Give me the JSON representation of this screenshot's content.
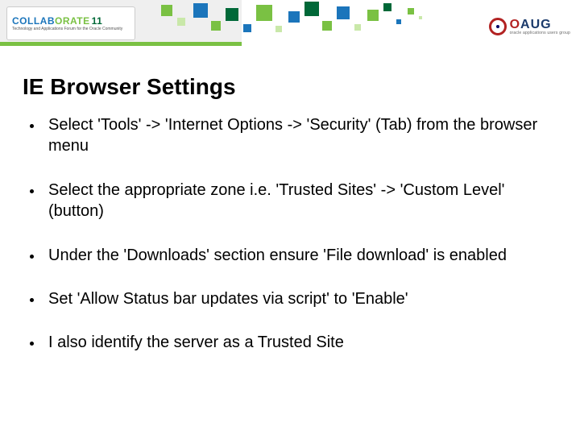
{
  "header": {
    "collab_word1": "COLLAB",
    "collab_word2": "ORATE",
    "collab_year": "11",
    "collab_sub": "Technology and Applications Forum for the Oracle Community",
    "oaug_o": "O",
    "oaug_aug": "AUG",
    "oaug_sub": "oracle applications users group"
  },
  "title": "IE Browser Settings",
  "bullets": [
    "Select 'Tools' -> 'Internet Options -> 'Security' (Tab) from the browser menu",
    "Select the appropriate zone i.e. 'Trusted Sites' -> 'Custom Level' (button)",
    "Under the 'Downloads' section ensure 'File download' is enabled",
    "Set 'Allow Status bar updates via script' to 'Enable'",
    "I also identify the server as a Trusted Site"
  ]
}
